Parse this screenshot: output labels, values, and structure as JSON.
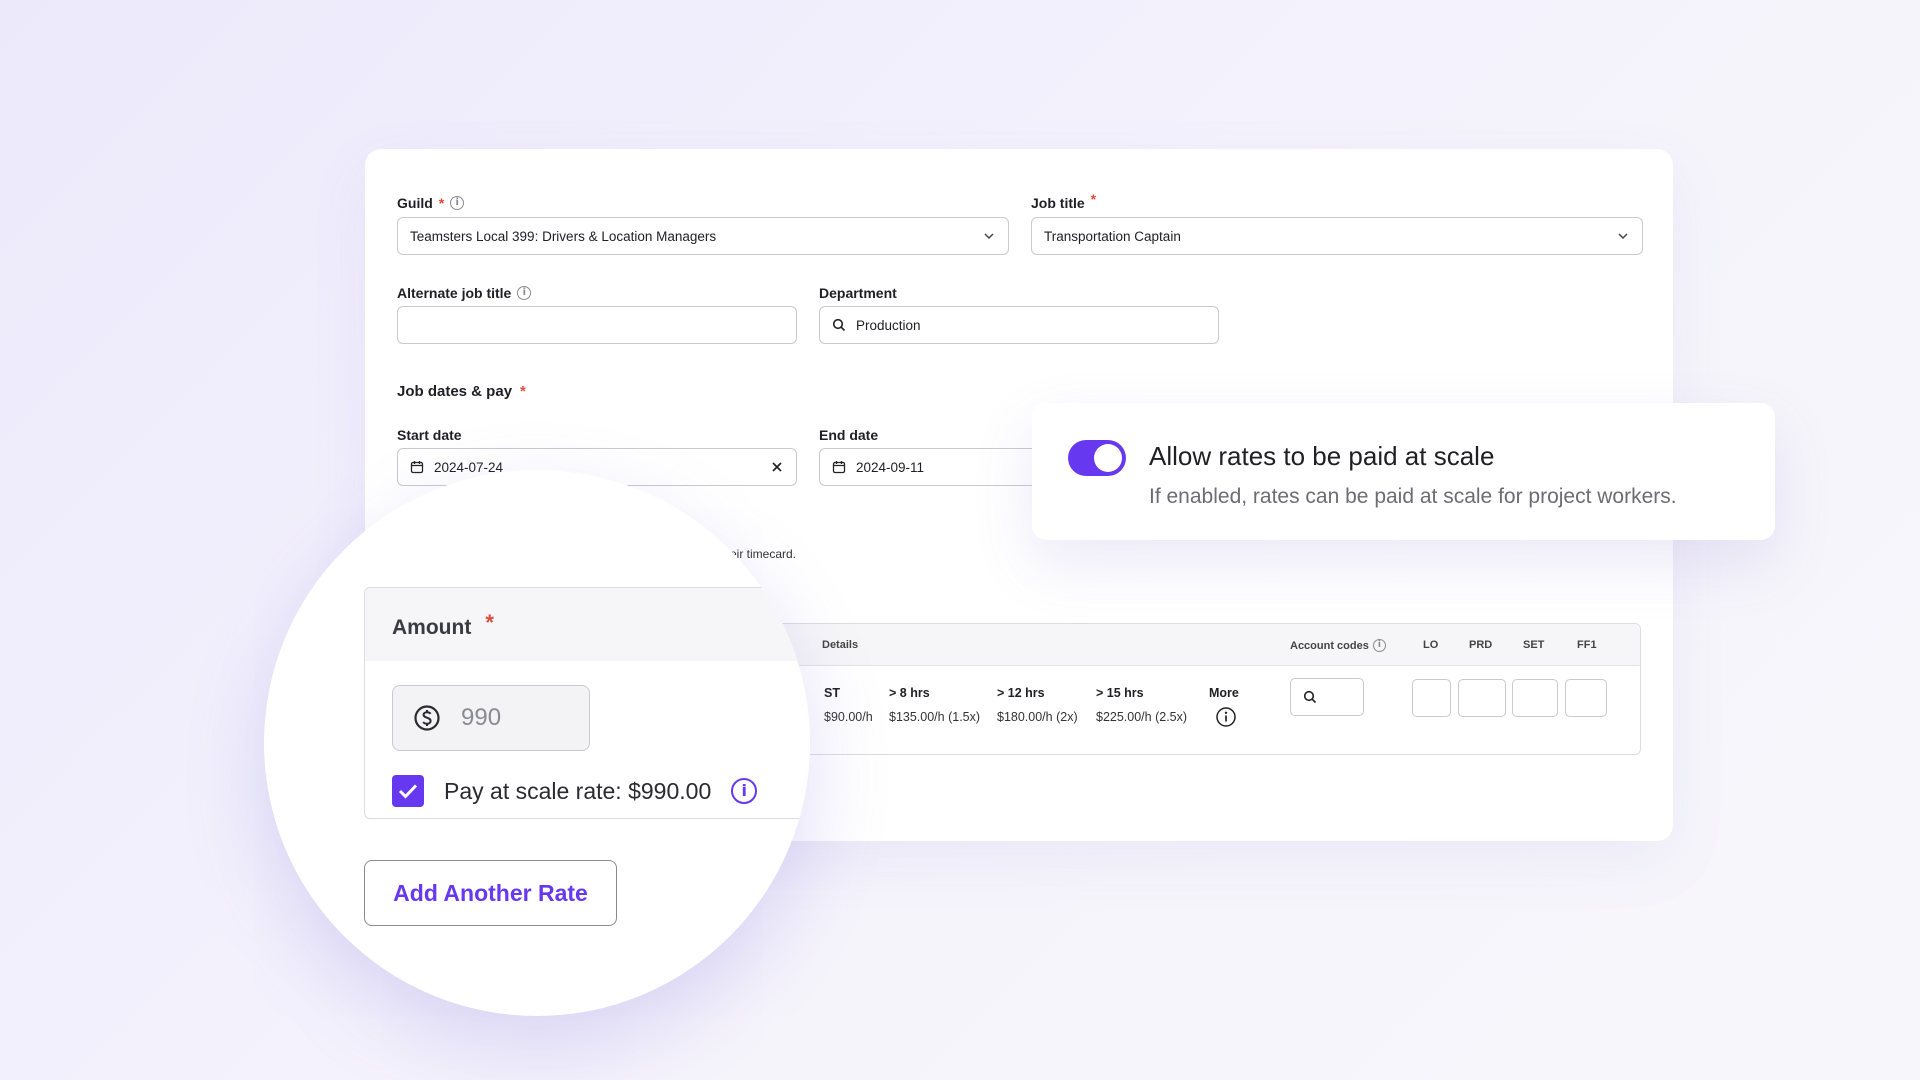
{
  "form": {
    "guild": {
      "label": "Guild",
      "value": "Teamsters Local 399: Drivers & Location Managers"
    },
    "job_title": {
      "label": "Job title",
      "value": "Transportation Captain"
    },
    "alternate_job_title": {
      "label": "Alternate job title",
      "value": ""
    },
    "department": {
      "label": "Department",
      "value": "Production"
    },
    "job_dates_pay": {
      "label": "Job dates & pay"
    },
    "start_date": {
      "label": "Start date",
      "value": "2024-07-24"
    },
    "end_date": {
      "label": "End date",
      "value": "2024-09-11"
    },
    "required_mark": "*",
    "info_glyph": "i"
  },
  "note_fragment": "eir timecard.",
  "rates_table": {
    "headers": {
      "details": "Details",
      "account_codes": "Account codes",
      "lo": "LO",
      "prd": "PRD",
      "set": "SET",
      "ff1": "FF1"
    },
    "columns": [
      {
        "header": "ST",
        "value": "$90.00/h"
      },
      {
        "header": "> 8 hrs",
        "value": "$135.00/h (1.5x)"
      },
      {
        "header": "> 12 hrs",
        "value": "$180.00/h (2x)"
      },
      {
        "header": "> 15 hrs",
        "value": "$225.00/h (2.5x)"
      }
    ],
    "more_label": "More"
  },
  "scale_toggle": {
    "enabled": true,
    "title": "Allow rates to be paid at scale",
    "description": "If enabled, rates can be paid at scale for project workers."
  },
  "amount": {
    "label": "Amount",
    "value": "990",
    "pay_at_scale_checked": true,
    "pay_at_scale_text": "Pay at scale rate: $990.00"
  },
  "add_rate_button": "Add Another Rate",
  "colors": {
    "accent": "#6638f0",
    "required": "#e04b3c"
  },
  "icons": [
    "chevron-down-icon",
    "info-icon",
    "search-icon",
    "calendar-icon",
    "close-icon",
    "dollar-icon",
    "checkmark-icon"
  ]
}
